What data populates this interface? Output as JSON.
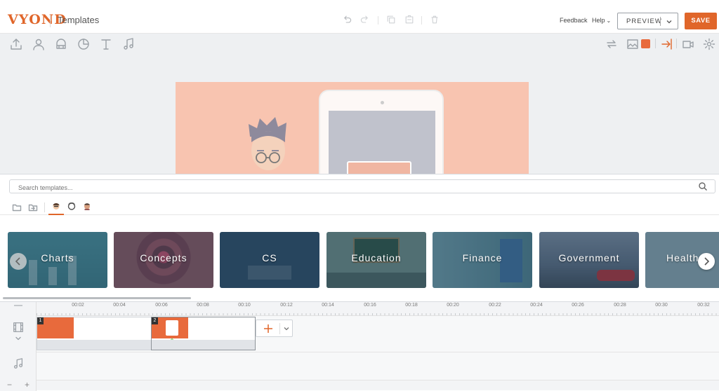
{
  "app": {
    "logo": "VYOND",
    "project_title": "Templates"
  },
  "header": {
    "feedback_label": "Feedback",
    "help_label": "Help",
    "preview_label": "PREVIEW",
    "save_label": "SAVE",
    "accent_color": "#e0662a"
  },
  "toolbar": {
    "left_icons": [
      "upload-icon",
      "character-icon",
      "props-icon",
      "chart-icon",
      "text-icon",
      "audio-icon"
    ],
    "right_icons": [
      "swap-icon",
      "background-image-icon",
      "background-color-icon",
      "enter-exit-icon",
      "camera-icon",
      "settings-icon"
    ],
    "canvas_background_color": "#f8c4b0"
  },
  "library": {
    "search_placeholder": "Search templates...",
    "tabs": [
      "folder-icon",
      "import-folder-icon",
      "contemporary-style-icon",
      "whiteboard-style-icon",
      "business-friendly-style-icon"
    ],
    "active_tab": "contemporary-style-icon",
    "categories": [
      {
        "label": "Charts",
        "color": "#3d7c8a"
      },
      {
        "label": "Concepts",
        "color": "#8c5560"
      },
      {
        "label": "CS",
        "color": "#2d4a66"
      },
      {
        "label": "Education",
        "color": "#5e7a78"
      },
      {
        "label": "Finance",
        "color": "#5d8a98"
      },
      {
        "label": "Government",
        "color": "#5b6a80"
      },
      {
        "label": "Health",
        "color": "#6f8a9a"
      }
    ]
  },
  "timeline": {
    "ticks": [
      "00:02",
      "00:04",
      "00:06",
      "00:08",
      "00:10",
      "00:12",
      "00:14",
      "00:16",
      "00:18",
      "00:20",
      "00:22",
      "00:24",
      "00:26",
      "00:28",
      "00:30",
      "00:32"
    ],
    "scenes": [
      {
        "number": "1"
      },
      {
        "number": "2"
      }
    ],
    "zoom_out_label": "−",
    "zoom_in_label": "+"
  }
}
